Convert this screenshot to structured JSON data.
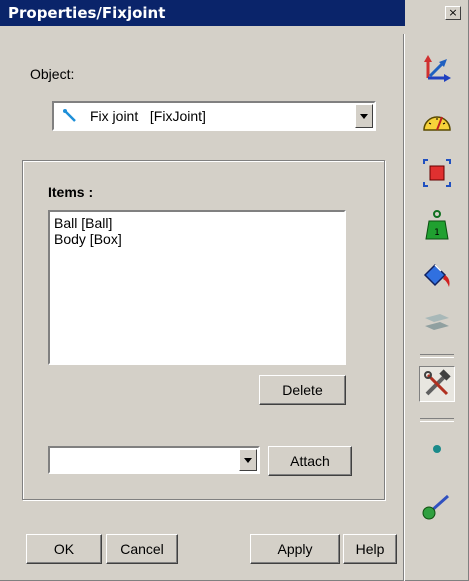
{
  "window": {
    "title": "Properties/Fixjoint",
    "close_glyph": "×"
  },
  "object": {
    "label": "Object:",
    "selected": "Fix joint   [FixJoint]"
  },
  "items": {
    "label": "Items :",
    "list": [
      "Ball [Ball]",
      "Body [Box]"
    ],
    "delete_label": "Delete",
    "attach_value": "",
    "attach_label": "Attach"
  },
  "footer": {
    "ok": "OK",
    "cancel": "Cancel",
    "apply": "Apply",
    "help": "Help"
  },
  "toolbar": {
    "tools": [
      "axes-icon",
      "gauge-icon",
      "bounding-box-icon",
      "mass-icon",
      "paint-bucket-icon",
      "layers-icon",
      "tools-icon",
      "point-icon",
      "link-icon"
    ]
  }
}
